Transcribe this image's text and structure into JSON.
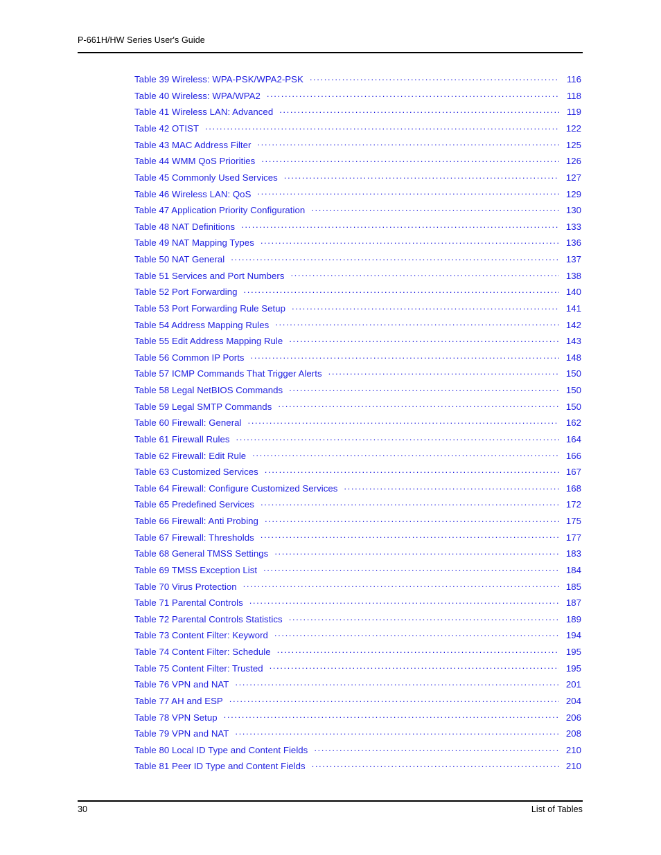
{
  "header": {
    "title": "P-661H/HW Series User's Guide"
  },
  "footer": {
    "page_number": "30",
    "section": "List of Tables"
  },
  "colors": {
    "entry_text": "#2020e0",
    "header_text": "#000000",
    "rule": "#000000"
  },
  "toc": {
    "entries": [
      {
        "label": "Table 39 Wireless: WPA-PSK/WPA2-PSK",
        "page": "116"
      },
      {
        "label": "Table 40 Wireless: WPA/WPA2",
        "page": "118"
      },
      {
        "label": "Table 41 Wireless LAN: Advanced",
        "page": "119"
      },
      {
        "label": "Table 42 OTIST",
        "page": "122"
      },
      {
        "label": "Table 43 MAC Address Filter",
        "page": "125"
      },
      {
        "label": "Table 44 WMM QoS Priorities",
        "page": "126"
      },
      {
        "label": "Table 45 Commonly Used Services",
        "page": "127"
      },
      {
        "label": "Table 46 Wireless LAN: QoS",
        "page": "129"
      },
      {
        "label": "Table 47 Application Priority Configuration",
        "page": "130"
      },
      {
        "label": "Table 48 NAT Definitions",
        "page": "133"
      },
      {
        "label": "Table 49 NAT Mapping Types",
        "page": "136"
      },
      {
        "label": "Table 50 NAT General",
        "page": "137"
      },
      {
        "label": "Table 51 Services and Port Numbers",
        "page": "138"
      },
      {
        "label": "Table 52 Port Forwarding",
        "page": "140"
      },
      {
        "label": "Table 53 Port Forwarding Rule Setup",
        "page": "141"
      },
      {
        "label": "Table 54 Address Mapping Rules",
        "page": "142"
      },
      {
        "label": "Table 55 Edit Address Mapping Rule",
        "page": "143"
      },
      {
        "label": "Table 56 Common IP Ports",
        "page": "148"
      },
      {
        "label": "Table 57 ICMP Commands That Trigger Alerts",
        "page": "150"
      },
      {
        "label": "Table 58 Legal NetBIOS Commands",
        "page": "150"
      },
      {
        "label": "Table 59 Legal SMTP Commands",
        "page": "150"
      },
      {
        "label": "Table 60 Firewall: General",
        "page": "162"
      },
      {
        "label": "Table 61 Firewall Rules",
        "page": "164"
      },
      {
        "label": "Table 62 Firewall: Edit Rule",
        "page": "166"
      },
      {
        "label": "Table 63 Customized Services",
        "page": "167"
      },
      {
        "label": "Table 64 Firewall: Configure Customized Services",
        "page": "168"
      },
      {
        "label": "Table 65 Predefined Services",
        "page": "172"
      },
      {
        "label": "Table 66 Firewall: Anti Probing",
        "page": "175"
      },
      {
        "label": "Table 67 Firewall: Thresholds",
        "page": "177"
      },
      {
        "label": "Table 68 General TMSS Settings",
        "page": "183"
      },
      {
        "label": "Table 69 TMSS Exception List",
        "page": "184"
      },
      {
        "label": "Table 70 Virus Protection",
        "page": "185"
      },
      {
        "label": "Table 71 Parental Controls",
        "page": "187"
      },
      {
        "label": "Table 72 Parental Controls Statistics",
        "page": "189"
      },
      {
        "label": "Table 73 Content Filter: Keyword",
        "page": "194"
      },
      {
        "label": "Table 74 Content Filter: Schedule",
        "page": "195"
      },
      {
        "label": "Table 75 Content Filter: Trusted",
        "page": "195"
      },
      {
        "label": "Table 76 VPN and NAT",
        "page": "201"
      },
      {
        "label": "Table 77 AH and ESP",
        "page": "204"
      },
      {
        "label": "Table 78 VPN Setup",
        "page": "206"
      },
      {
        "label": "Table 79 VPN and NAT",
        "page": "208"
      },
      {
        "label": "Table 80 Local ID Type and Content Fields",
        "page": "210"
      },
      {
        "label": "Table 81 Peer ID Type and Content Fields",
        "page": "210"
      }
    ]
  }
}
